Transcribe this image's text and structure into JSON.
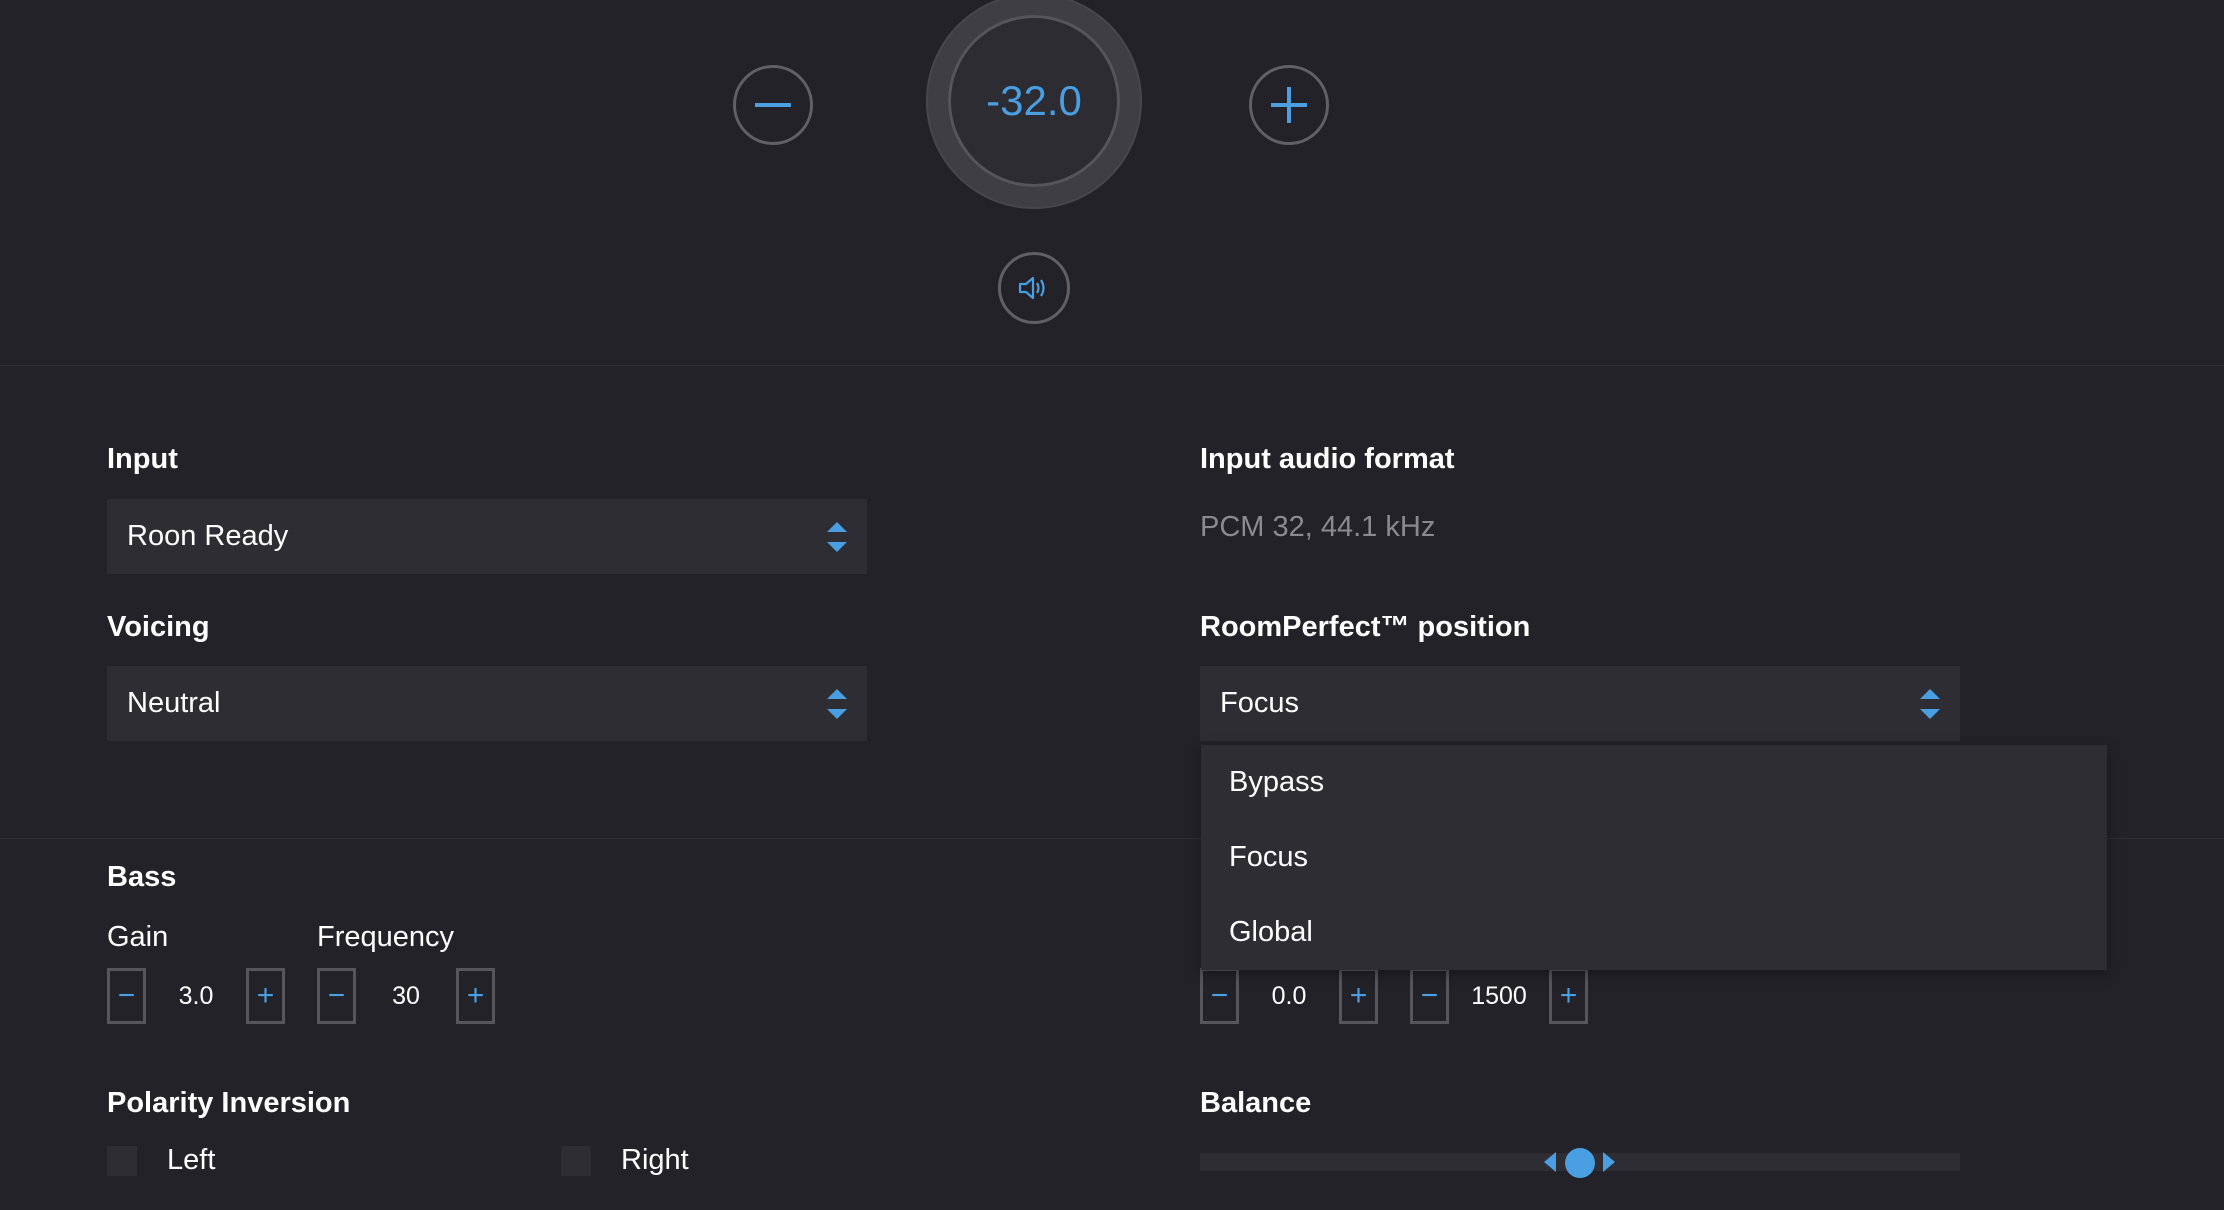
{
  "volume": {
    "value": "-32.0",
    "minus_icon": "minus-icon",
    "plus_icon": "plus-icon",
    "mute_icon": "speaker-icon"
  },
  "input": {
    "label": "Input",
    "selected": "Roon Ready"
  },
  "input_audio_format": {
    "label": "Input audio format",
    "value": "PCM 32, 44.1 kHz"
  },
  "voicing": {
    "label": "Voicing",
    "selected": "Neutral"
  },
  "roomperfect": {
    "label": "RoomPerfect™ position",
    "selected": "Focus",
    "options": [
      "Bypass",
      "Focus",
      "Global"
    ]
  },
  "bass": {
    "label": "Bass",
    "gain_label": "Gain",
    "gain_value": "3.0",
    "frequency_label": "Frequency",
    "frequency_value": "30"
  },
  "treble": {
    "gain_value": "0.0",
    "frequency_value": "1500"
  },
  "polarity": {
    "label": "Polarity Inversion",
    "left_label": "Left",
    "right_label": "Right"
  },
  "balance": {
    "label": "Balance",
    "position": 0.5
  },
  "colors": {
    "accent": "#4a9fe2",
    "background": "#222228",
    "control": "#2d2d33"
  }
}
